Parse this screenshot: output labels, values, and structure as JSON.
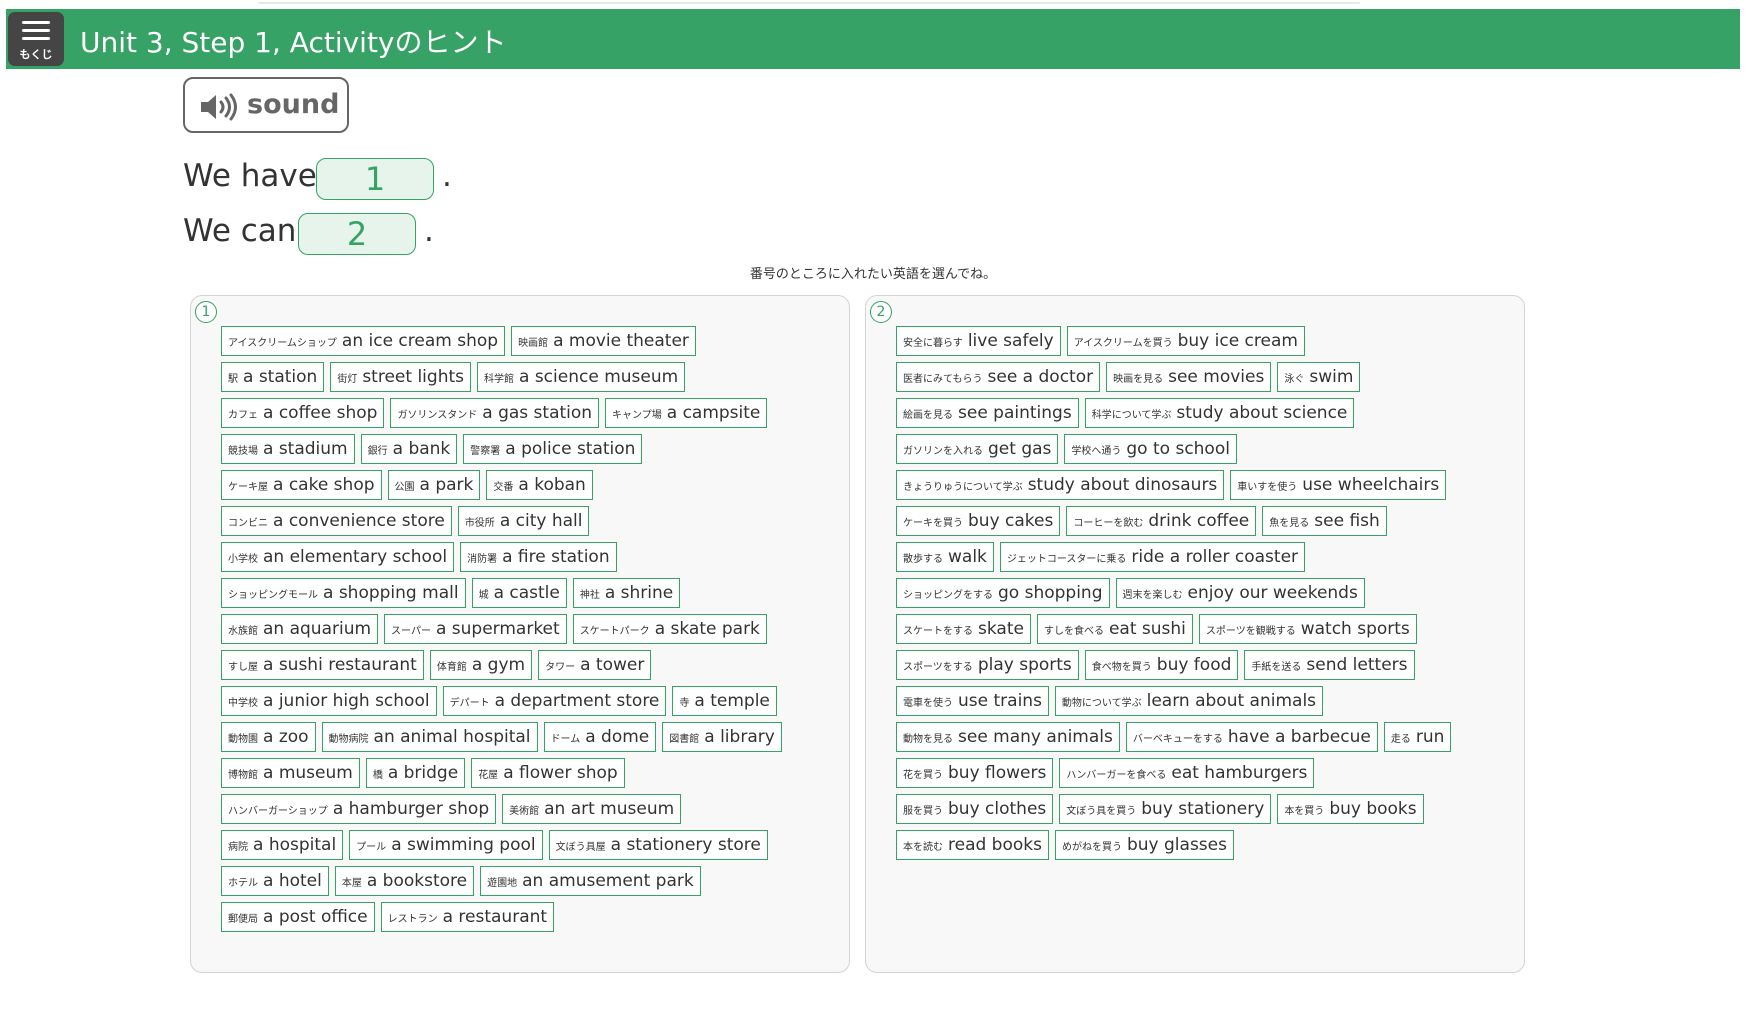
{
  "header": {
    "toc_label": "もくじ",
    "title": "Unit 3, Step 1, Activityのヒント",
    "color": "#36a265"
  },
  "sound_button": {
    "label": "sound",
    "icon": "speaker-icon"
  },
  "sentences": [
    {
      "prefix": "We have",
      "blank": "1",
      "suffix": "."
    },
    {
      "prefix": "We can",
      "blank": "2",
      "suffix": "."
    }
  ],
  "instruction": "番号のところに入れたい英語を選んでね。",
  "panels": [
    {
      "number": "1",
      "rows": [
        [
          {
            "ja": "アイスクリームショップ",
            "en": "an ice cream shop"
          },
          {
            "ja": "映画館",
            "en": "a movie theater"
          }
        ],
        [
          {
            "ja": "駅",
            "en": "a station"
          },
          {
            "ja": "街灯",
            "en": "street lights"
          },
          {
            "ja": "科学館",
            "en": "a science museum"
          }
        ],
        [
          {
            "ja": "カフェ",
            "en": "a coffee shop"
          },
          {
            "ja": "ガソリンスタンド",
            "en": "a gas station"
          },
          {
            "ja": "キャンプ場",
            "en": "a campsite"
          }
        ],
        [
          {
            "ja": "競技場",
            "en": "a stadium"
          },
          {
            "ja": "銀行",
            "en": "a bank"
          },
          {
            "ja": "警察署",
            "en": "a police station"
          }
        ],
        [
          {
            "ja": "ケーキ屋",
            "en": "a cake shop"
          },
          {
            "ja": "公園",
            "en": "a park"
          },
          {
            "ja": "交番",
            "en": "a koban"
          }
        ],
        [
          {
            "ja": "コンビニ",
            "en": "a convenience store"
          },
          {
            "ja": "市役所",
            "en": "a city hall"
          }
        ],
        [
          {
            "ja": "小学校",
            "en": "an elementary school"
          },
          {
            "ja": "消防署",
            "en": "a fire station"
          }
        ],
        [
          {
            "ja": "ショッピングモール",
            "en": "a shopping mall"
          },
          {
            "ja": "城",
            "en": "a castle"
          },
          {
            "ja": "神社",
            "en": "a shrine"
          }
        ],
        [
          {
            "ja": "水族館",
            "en": "an aquarium"
          },
          {
            "ja": "スーパー",
            "en": "a supermarket"
          },
          {
            "ja": "スケートパーク",
            "en": "a skate park"
          }
        ],
        [
          {
            "ja": "すし屋",
            "en": "a sushi restaurant"
          },
          {
            "ja": "体育館",
            "en": "a gym"
          },
          {
            "ja": "タワー",
            "en": "a tower"
          }
        ],
        [
          {
            "ja": "中学校",
            "en": "a junior high school"
          },
          {
            "ja": "デパート",
            "en": "a department store"
          },
          {
            "ja": "寺",
            "en": "a temple"
          }
        ],
        [
          {
            "ja": "動物園",
            "en": "a zoo"
          },
          {
            "ja": "動物病院",
            "en": "an animal hospital"
          },
          {
            "ja": "ドーム",
            "en": "a dome"
          },
          {
            "ja": "図書館",
            "en": "a library"
          }
        ],
        [
          {
            "ja": "博物館",
            "en": "a museum"
          },
          {
            "ja": "橋",
            "en": "a bridge"
          },
          {
            "ja": "花屋",
            "en": "a flower shop"
          }
        ],
        [
          {
            "ja": "ハンバーガーショップ",
            "en": "a hamburger shop"
          },
          {
            "ja": "美術館",
            "en": "an art museum"
          }
        ],
        [
          {
            "ja": "病院",
            "en": "a hospital"
          },
          {
            "ja": "プール",
            "en": "a swimming pool"
          },
          {
            "ja": "文ぼう具屋",
            "en": "a stationery store"
          }
        ],
        [
          {
            "ja": "ホテル",
            "en": "a hotel"
          },
          {
            "ja": "本屋",
            "en": "a bookstore"
          },
          {
            "ja": "遊園地",
            "en": "an amusement park"
          }
        ],
        [
          {
            "ja": "郵便局",
            "en": "a post office"
          },
          {
            "ja": "レストラン",
            "en": "a restaurant"
          }
        ]
      ]
    },
    {
      "number": "2",
      "rows": [
        [
          {
            "ja": "安全に暮らす",
            "en": "live safely"
          },
          {
            "ja": "アイスクリームを買う",
            "en": "buy ice cream"
          }
        ],
        [
          {
            "ja": "医者にみてもらう",
            "en": "see a doctor"
          },
          {
            "ja": "映画を見る",
            "en": "see movies"
          },
          {
            "ja": "泳ぐ",
            "en": "swim"
          }
        ],
        [
          {
            "ja": "絵画を見る",
            "en": "see paintings"
          },
          {
            "ja": "科学について学ぶ",
            "en": "study about science"
          }
        ],
        [
          {
            "ja": "ガソリンを入れる",
            "en": "get gas"
          },
          {
            "ja": "学校へ通う",
            "en": "go to school"
          }
        ],
        [
          {
            "ja": "きょうりゅうについて学ぶ",
            "en": "study about dinosaurs"
          },
          {
            "ja": "車いすを使う",
            "en": "use wheelchairs"
          }
        ],
        [
          {
            "ja": "ケーキを買う",
            "en": "buy cakes"
          },
          {
            "ja": "コーヒーを飲む",
            "en": "drink coffee"
          },
          {
            "ja": "魚を見る",
            "en": "see fish"
          }
        ],
        [
          {
            "ja": "散歩する",
            "en": "walk"
          },
          {
            "ja": "ジェットコースターに乗る",
            "en": "ride a roller coaster"
          }
        ],
        [
          {
            "ja": "ショッピングをする",
            "en": "go shopping"
          },
          {
            "ja": "週末を楽しむ",
            "en": "enjoy our weekends"
          }
        ],
        [
          {
            "ja": "スケートをする",
            "en": "skate"
          },
          {
            "ja": "すしを食べる",
            "en": "eat sushi"
          },
          {
            "ja": "スポーツを観戦する",
            "en": "watch sports"
          }
        ],
        [
          {
            "ja": "スポーツをする",
            "en": "play sports"
          },
          {
            "ja": "食べ物を買う",
            "en": "buy food"
          },
          {
            "ja": "手紙を送る",
            "en": "send letters"
          }
        ],
        [
          {
            "ja": "電車を使う",
            "en": "use trains"
          },
          {
            "ja": "動物について学ぶ",
            "en": "learn about animals"
          }
        ],
        [
          {
            "ja": "動物を見る",
            "en": "see many animals"
          },
          {
            "ja": "バーベキューをする",
            "en": "have a barbecue"
          },
          {
            "ja": "走る",
            "en": "run"
          }
        ],
        [
          {
            "ja": "花を買う",
            "en": "buy flowers"
          },
          {
            "ja": "ハンバーガーを食べる",
            "en": "eat hamburgers"
          }
        ],
        [
          {
            "ja": "服を買う",
            "en": "buy clothes"
          },
          {
            "ja": "文ぼう具を買う",
            "en": "buy stationery"
          },
          {
            "ja": "本を買う",
            "en": "buy books"
          }
        ],
        [
          {
            "ja": "本を読む",
            "en": "read books"
          },
          {
            "ja": "めがねを買う",
            "en": "buy glasses"
          }
        ]
      ]
    }
  ]
}
